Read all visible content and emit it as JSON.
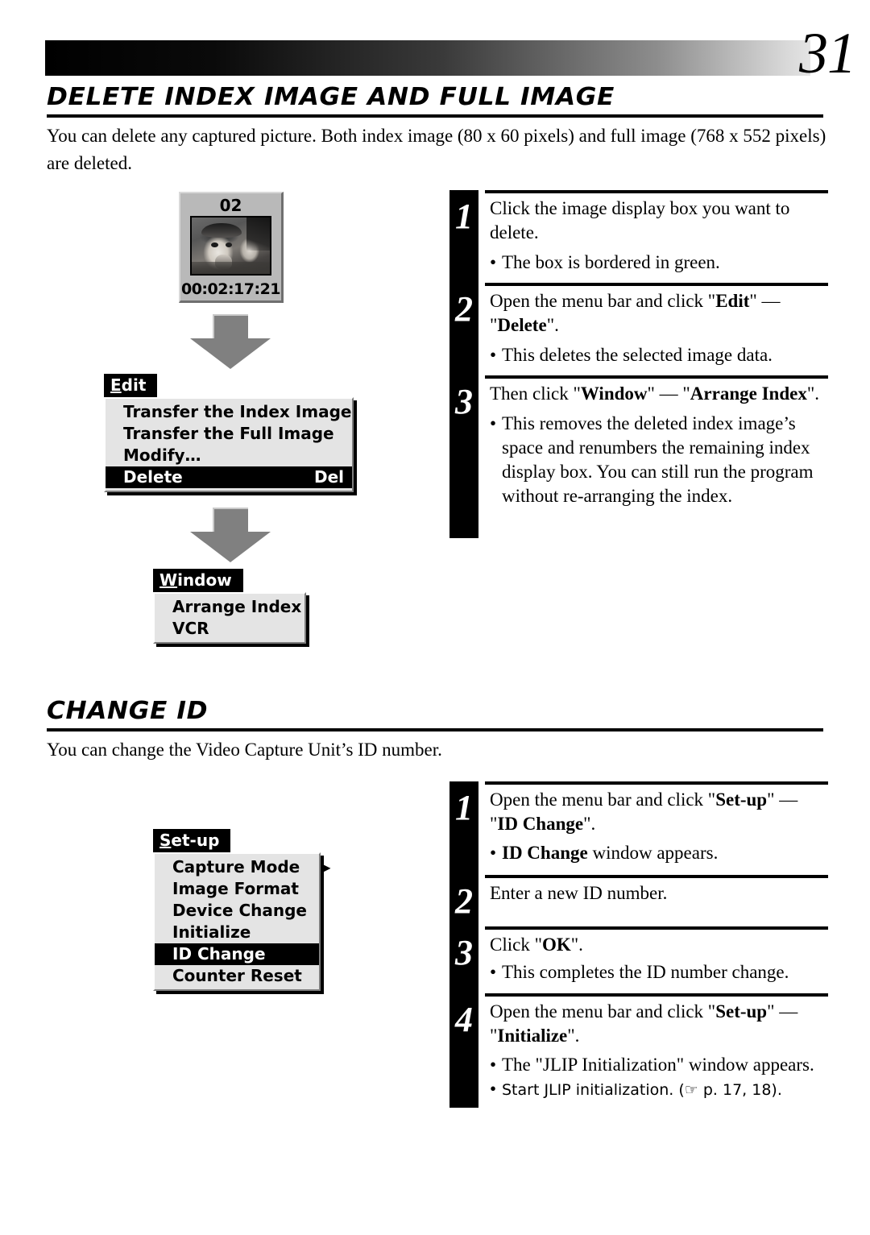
{
  "page": {
    "number": "31"
  },
  "sections": [
    {
      "id": "delete-index-image",
      "heading": "DELETE INDEX IMAGE AND FULL IMAGE",
      "intro": "You can delete any captured picture. Both index image (80 x 60 pixels) and full image (768 x 552 pixels) are deleted.",
      "illustration": {
        "image_box": {
          "index_number": "02",
          "timecode": "00:02:17:21"
        },
        "menus": [
          {
            "title": "Edit",
            "title_accesskey": "E",
            "items": [
              {
                "label": "Transfer the Index Image",
                "shortcut": "",
                "selected": false,
                "submenu": false
              },
              {
                "label": "Transfer the Full Image",
                "shortcut": "",
                "selected": false,
                "submenu": false
              },
              {
                "label": "Modify…",
                "shortcut": "",
                "selected": false,
                "submenu": false
              },
              {
                "label": "Delete",
                "shortcut": "Del",
                "selected": true,
                "submenu": false
              }
            ]
          },
          {
            "title": "Window",
            "title_accesskey": "W",
            "items": [
              {
                "label": "Arrange Index",
                "shortcut": "",
                "selected": false,
                "submenu": false
              },
              {
                "label": "VCR",
                "shortcut": "",
                "selected": false,
                "submenu": false
              }
            ]
          }
        ]
      },
      "steps": [
        {
          "number": "1",
          "text_parts": [
            {
              "t": "Click the image display box you want to delete.",
              "bold": false
            }
          ],
          "bullets": [
            [
              {
                "t": "The box is bordered in green.",
                "bold": false
              }
            ]
          ]
        },
        {
          "number": "2",
          "text_parts": [
            {
              "t": "Open the menu bar and click \"",
              "bold": false
            },
            {
              "t": "Edit",
              "bold": true
            },
            {
              "t": "\" — \"",
              "bold": false
            },
            {
              "t": "Delete",
              "bold": true
            },
            {
              "t": "\".",
              "bold": false
            }
          ],
          "bullets": [
            [
              {
                "t": "This deletes the selected image data.",
                "bold": false
              }
            ]
          ]
        },
        {
          "number": "3",
          "text_parts": [
            {
              "t": "Then click \"",
              "bold": false
            },
            {
              "t": "Window",
              "bold": true
            },
            {
              "t": "\" — \"",
              "bold": false
            },
            {
              "t": "Arrange Index",
              "bold": true
            },
            {
              "t": "\".",
              "bold": false
            }
          ],
          "bullets": [
            [
              {
                "t": "This removes the deleted index image’s space and renumbers the remaining index display box.  You can still run the program without re-arranging the index.",
                "bold": false
              }
            ]
          ]
        }
      ]
    },
    {
      "id": "change-id",
      "heading": "CHANGE ID",
      "intro": "You can change the Video Capture Unit’s ID number.",
      "illustration": {
        "menus": [
          {
            "title": "Set-up",
            "title_accesskey": "S",
            "items": [
              {
                "label": "Capture Mode",
                "shortcut": "",
                "selected": false,
                "submenu": true
              },
              {
                "label": "Image Format",
                "shortcut": "",
                "selected": false,
                "submenu": false
              },
              {
                "label": "Device Change",
                "shortcut": "",
                "selected": false,
                "submenu": false
              },
              {
                "label": "Initialize",
                "shortcut": "",
                "selected": false,
                "submenu": false
              },
              {
                "label": "ID Change",
                "shortcut": "",
                "selected": true,
                "submenu": false
              },
              {
                "label": "Counter Reset",
                "shortcut": "",
                "selected": false,
                "submenu": false
              }
            ]
          }
        ]
      },
      "steps": [
        {
          "number": "1",
          "text_parts": [
            {
              "t": "Open the menu bar and click \"",
              "bold": false
            },
            {
              "t": "Set-up",
              "bold": true
            },
            {
              "t": "\" — \"",
              "bold": false
            },
            {
              "t": "ID Change",
              "bold": true
            },
            {
              "t": "\".",
              "bold": false
            }
          ],
          "bullets": [
            [
              {
                "t": "ID Change",
                "bold": true
              },
              {
                "t": " window appears.",
                "bold": false
              }
            ]
          ]
        },
        {
          "number": "2",
          "text_parts": [
            {
              "t": "Enter a new ID number.",
              "bold": false
            }
          ],
          "bullets": []
        },
        {
          "number": "3",
          "text_parts": [
            {
              "t": "Click \"",
              "bold": false
            },
            {
              "t": "OK",
              "bold": true
            },
            {
              "t": "\".",
              "bold": false
            }
          ],
          "bullets": [
            [
              {
                "t": "This completes the ID number change.",
                "bold": false
              }
            ]
          ]
        },
        {
          "number": "4",
          "text_parts": [
            {
              "t": "Open the menu bar and click \"",
              "bold": false
            },
            {
              "t": "Set-up",
              "bold": true
            },
            {
              "t": "\" — \"",
              "bold": false
            },
            {
              "t": "Initialize",
              "bold": true
            },
            {
              "t": "\".",
              "bold": false
            }
          ],
          "bullets": [
            [
              {
                "t": "The \"JLIP Initialization\" window appears.",
                "bold": false
              }
            ],
            [
              {
                "t": "Start JLIP initialization. (☞ p. 17, 18).",
                "bold": false
              }
            ]
          ]
        }
      ]
    }
  ]
}
